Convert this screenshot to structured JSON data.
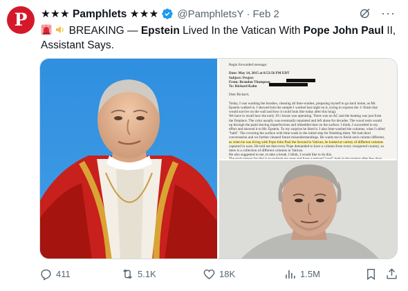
{
  "account": {
    "avatar_letter": "P",
    "display_name": "★★★ Pamphlets ★★★",
    "handle": "@PamphletsY",
    "separator": "·",
    "date": "Feb 2"
  },
  "tweet": {
    "emoji": [
      "rotating-light-icon",
      "speaker-icon"
    ],
    "text_parts": [
      {
        "t": "BREAKING — ",
        "bold": false
      },
      {
        "t": "Epstein",
        "bold": true
      },
      {
        "t": " Lived In the Vatican With ",
        "bold": false
      },
      {
        "t": "Pope John Paul",
        "bold": true
      },
      {
        "t": " II, Assistant Says.",
        "bold": false
      }
    ]
  },
  "document": {
    "lines": [
      {
        "t": "Begin forwarded message:",
        "style": "normal"
      },
      {
        "t": "",
        "style": "normal"
      },
      {
        "t": "Date: May 14, 2015 at 8:53:56 PM EDT",
        "style": "strong"
      },
      {
        "t": "Subject: Project",
        "style": "strong"
      },
      {
        "t": "From: Brandon Thompson",
        "style": "strong"
      },
      {
        "t": "To: Richard Kahn",
        "style": "strong"
      },
      {
        "t": "",
        "style": "normal"
      },
      {
        "t": "Dear Richard,",
        "style": "normal"
      },
      {
        "t": "",
        "style": "normal"
      },
      {
        "t": "Today, I was washing the brushes, cleaning all lime-washes, preparing myself to go back home, as Mr.",
        "style": "normal"
      },
      {
        "t": "Epstein walked in. I showed him the sample I worked last night on it, trying to express the 1/ finish that",
        "style": "normal"
      },
      {
        "t": "would survive on the wall and how it could look like today after this long).",
        "style": "normal"
      },
      {
        "t": "We have to recall how the early 19 c house was operating. There was no AC and the heating was just from",
        "style": "normal"
      },
      {
        "t": "the fireplace. The color usually was eventually repainted and left alone for decades. The wood resin would",
        "style": "normal"
      },
      {
        "t": "up through the paint leaving imperfections and imbedded dust on the surface. I think, I succeeded in my",
        "style": "normal"
      },
      {
        "t": "effort and showed it to Mr. Epstein. To my surprise he liked it. I also lime-washed the columns, what I called",
        "style": "normal"
      },
      {
        "t": "\"bald\". The covering the surface with lime-wash in the initial step for finishing them. We had short",
        "style": "normal"
      },
      {
        "t": "conversation and we further cleaned future misunderstandings. He wants me to finish each column different,",
        "style": "normal"
      },
      {
        "t": "as when he was living with Pope John Paul the Second in Vatican, he looked at variety of different columns",
        "style": "highlight"
      },
      {
        "t": "captured in wars. He told me that every Pope demanded to have a column from every conquered country, so",
        "style": "normal"
      },
      {
        "t": "there is a collection of different columns in Vatican.",
        "style": "normal"
      },
      {
        "t": "He also suggested to me, to take a break. I think, I would like to do this.",
        "style": "normal"
      },
      {
        "t": "The main reason for this is to re-fresh my eyes and have a relaxed \"cool\" look in the project after few days.",
        "style": "normal"
      },
      {
        "t": "From my experience it works well. He also suggested that I will come with Bart. I am not sure how long can",
        "style": "normal"
      }
    ]
  },
  "actions": {
    "replies": "411",
    "reposts": "5.1K",
    "likes": "18K",
    "views": "1.5M"
  },
  "colors": {
    "avatar_bg": "#d4182a",
    "verified_blue": "#1d9bf0",
    "muted": "#536471"
  },
  "icons": [
    "verified-badge-icon",
    "grok-icon",
    "more-icon",
    "reply-icon",
    "repost-icon",
    "like-icon",
    "views-icon",
    "bookmark-icon",
    "share-icon"
  ]
}
